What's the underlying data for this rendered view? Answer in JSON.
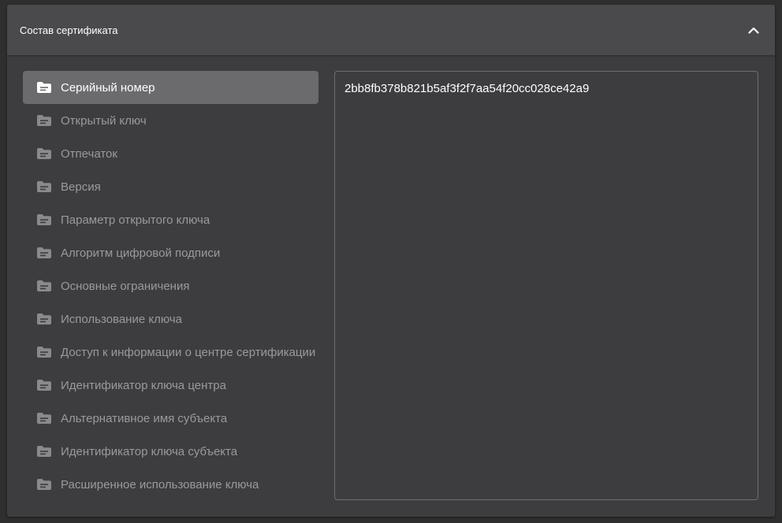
{
  "panel": {
    "title": "Состав сертификата",
    "collapse_icon": "chevron-up-icon"
  },
  "fields": [
    {
      "label": "Серийный номер",
      "icon": "folder-icon",
      "active": true
    },
    {
      "label": "Открытый ключ",
      "icon": "folder-icon",
      "active": false
    },
    {
      "label": "Отпечаток",
      "icon": "folder-icon",
      "active": false
    },
    {
      "label": "Версия",
      "icon": "folder-icon",
      "active": false
    },
    {
      "label": "Параметр открытого ключа",
      "icon": "folder-icon",
      "active": false
    },
    {
      "label": "Алгоритм цифровой подписи",
      "icon": "folder-icon",
      "active": false
    },
    {
      "label": "Основные ограничения",
      "icon": "folder-icon",
      "active": false
    },
    {
      "label": "Использование ключа",
      "icon": "folder-icon",
      "active": false
    },
    {
      "label": "Доступ к информации о центре сертификации",
      "icon": "folder-icon",
      "active": false
    },
    {
      "label": "Идентификатор ключа центра",
      "icon": "folder-icon",
      "active": false
    },
    {
      "label": "Альтернативное имя субъекта",
      "icon": "folder-icon",
      "active": false
    },
    {
      "label": "Идентификатор ключа субъекта",
      "icon": "folder-icon",
      "active": false
    },
    {
      "label": "Расширенное использование ключа",
      "icon": "folder-icon",
      "active": false
    }
  ],
  "selected_value": "2bb8fb378b821b5af3f2f7aa54f20cc028ce42a9",
  "colors": {
    "background": "#2f2f30",
    "panel": "#3d3d3f",
    "header": "#4a4a4c",
    "active_item": "#6b6b6d",
    "inactive_text": "#9a9a9c"
  }
}
